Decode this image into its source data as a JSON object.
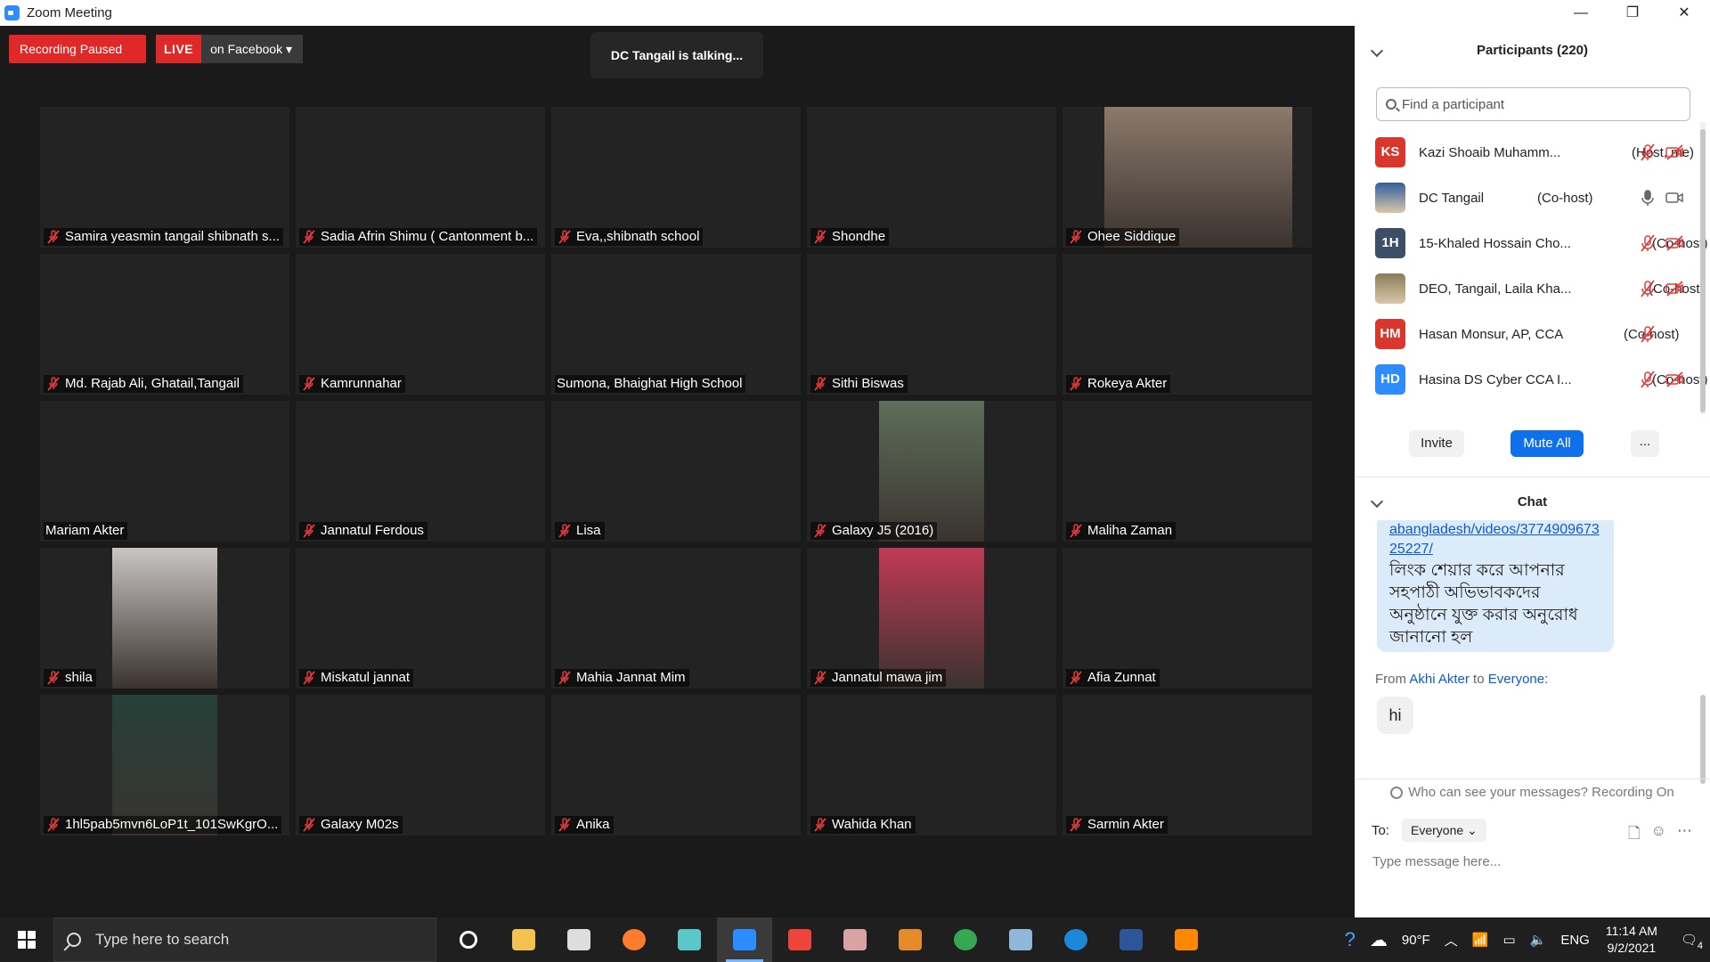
{
  "window": {
    "title": "Zoom Meeting",
    "minimize": "—",
    "restore": "❐",
    "close": "✕"
  },
  "meeting": {
    "recording_status": "Recording Paused",
    "live_label": "LIVE",
    "live_target": "on Facebook ▾",
    "talking": "DC Tangail is talking..."
  },
  "tiles": [
    {
      "name": "Samira yeasmin tangail shibnath s...",
      "muted": true,
      "cam": ""
    },
    {
      "name": "Sadia Afrin Shimu ( Cantonment b...",
      "muted": true,
      "cam": ""
    },
    {
      "name": "Eva,,shibnath school",
      "muted": true,
      "cam": ""
    },
    {
      "name": "Shondhe",
      "muted": true,
      "cam": ""
    },
    {
      "name": "Ohee Siddique",
      "muted": true,
      "cam": "wide"
    },
    {
      "name": "Md. Rajab Ali, Ghatail,Tangail",
      "muted": true,
      "cam": ""
    },
    {
      "name": "Kamrunnahar",
      "muted": true,
      "cam": ""
    },
    {
      "name": "Sumona, Bhaighat High  School",
      "muted": false,
      "cam": ""
    },
    {
      "name": "Sithi Biswas",
      "muted": true,
      "cam": ""
    },
    {
      "name": "Rokeya Akter",
      "muted": true,
      "cam": ""
    },
    {
      "name": "Mariam Akter",
      "muted": false,
      "cam": ""
    },
    {
      "name": "Jannatul Ferdous",
      "muted": true,
      "cam": ""
    },
    {
      "name": "Lisa",
      "muted": true,
      "cam": ""
    },
    {
      "name": "Galaxy J5 (2016)",
      "muted": true,
      "cam": "narrow"
    },
    {
      "name": "Maliha Zaman",
      "muted": true,
      "cam": ""
    },
    {
      "name": "shila",
      "muted": true,
      "cam": "narrow"
    },
    {
      "name": "Miskatul jannat",
      "muted": true,
      "cam": ""
    },
    {
      "name": "Mahia Jannat Mim",
      "muted": true,
      "cam": ""
    },
    {
      "name": "Jannatul mawa jim",
      "muted": true,
      "cam": "narrow"
    },
    {
      "name": "Afia Zunnat",
      "muted": true,
      "cam": ""
    },
    {
      "name": "1hl5pab5mvn6LoP1t_101SwKgrO...",
      "muted": true,
      "cam": "narrow"
    },
    {
      "name": "Galaxy M02s",
      "muted": true,
      "cam": ""
    },
    {
      "name": "Anika",
      "muted": true,
      "cam": ""
    },
    {
      "name": "Wahida Khan",
      "muted": true,
      "cam": ""
    },
    {
      "name": "Sarmin Akter",
      "muted": true,
      "cam": ""
    }
  ],
  "participants": {
    "title": "Participants (220)",
    "search_placeholder": "Find a participant",
    "list": [
      {
        "initials": "KS",
        "color": "#d8372c",
        "name": "Kazi Shoaib Muhamm...",
        "role": "(Host, me)",
        "mic": "muted",
        "video": "off",
        "photo": false
      },
      {
        "initials": "",
        "color": "#2f5f9e",
        "name": "DC Tangail",
        "role": "(Co-host)",
        "mic": "on",
        "video": "on",
        "photo": true
      },
      {
        "initials": "1H",
        "color": "#3d4f66",
        "name": "15-Khaled Hossain Cho...",
        "role": "(Co-host)",
        "mic": "muted",
        "video": "off",
        "photo": false
      },
      {
        "initials": "",
        "color": "#8a7d5a",
        "name": "DEO, Tangail, Laila Kha...",
        "role": "(Co-host)",
        "mic": "muted",
        "video": "off",
        "photo": true
      },
      {
        "initials": "HM",
        "color": "#d8372c",
        "name": "Hasan Monsur, AP, CCA",
        "role": "(Co-host)",
        "mic": "muted",
        "video": "none",
        "photo": false
      },
      {
        "initials": "HD",
        "color": "#2d8cff",
        "name": "Hasina DS Cyber CCA I...",
        "role": "(Co-host)",
        "mic": "muted",
        "video": "off",
        "photo": false
      }
    ],
    "invite": "Invite",
    "mute_all": "Mute All",
    "more": "..."
  },
  "chat": {
    "title": "Chat",
    "message1_link": "abangladesh/videos/377490967325227/",
    "message1_lines": [
      "লিংক শেয়ার করে আপনার",
      "সহপাঠী অভিভাবকদের",
      "অনুষ্ঠানে যুক্ত করার অনুরোধ",
      "জানানো হল"
    ],
    "from_prefix": "From",
    "from_name": "Akhi Akter",
    "to_word": "to",
    "to_name": "Everyone:",
    "message2": "hi",
    "who_can_see": "Who can see your messages? Recording On",
    "to_label": "To:",
    "to_value": "Everyone ⌄",
    "input_placeholder": "Type message here..."
  },
  "taskbar": {
    "search_placeholder": "Type here to search",
    "weather": "90°F",
    "language": "ENG",
    "time": "11:14 AM",
    "date": "9/2/2021",
    "notifications": "4"
  }
}
